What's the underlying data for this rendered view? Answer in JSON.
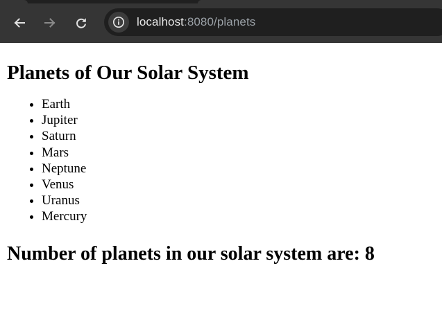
{
  "browser": {
    "url_host": "localhost",
    "url_rest": ":8080/planets",
    "icons": {
      "back": "back-arrow-icon",
      "forward": "forward-arrow-icon",
      "reload": "reload-icon",
      "site_info": "info-icon"
    },
    "colors": {
      "toolbar": "#353535",
      "omnibox": "#1f1f1f"
    }
  },
  "page": {
    "title": "Planets of Our Solar System",
    "planets": [
      "Earth",
      "Jupiter",
      "Saturn",
      "Mars",
      "Neptune",
      "Venus",
      "Uranus",
      "Mercury"
    ],
    "count_heading": "Number of planets in our solar system are: 8"
  }
}
